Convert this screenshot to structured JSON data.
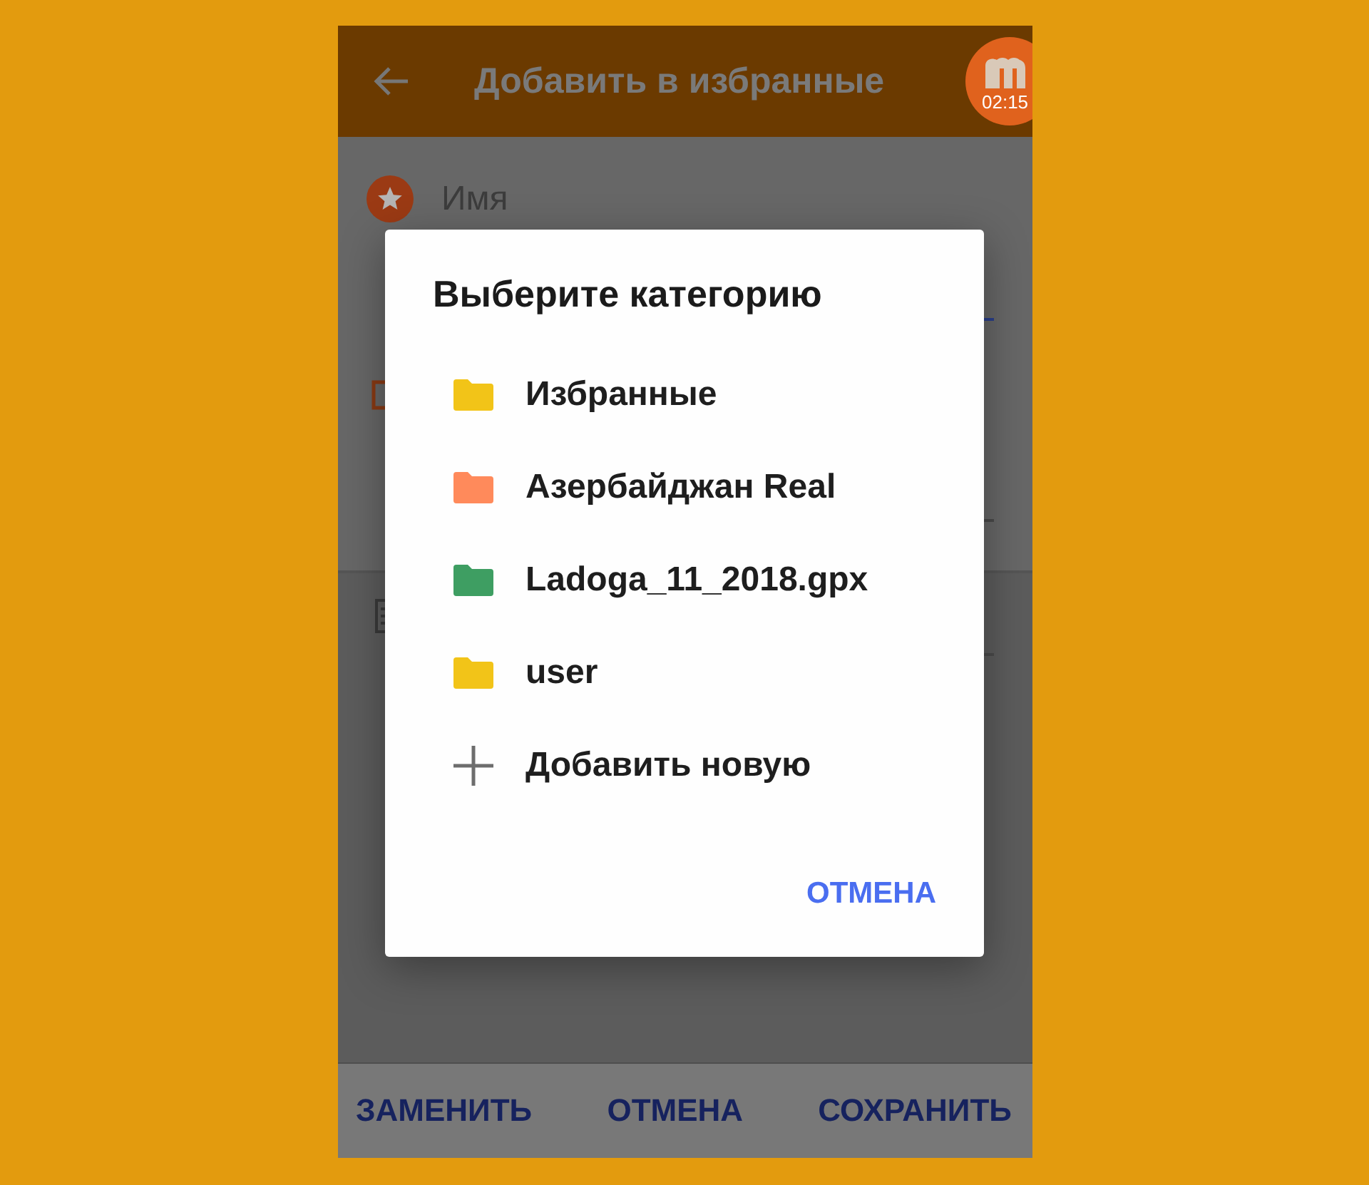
{
  "app_bar": {
    "title": "Добавить в избранные"
  },
  "recorder_badge": {
    "time": "02:15"
  },
  "form": {
    "name_label": "Имя"
  },
  "dialog": {
    "title": "Выберите категорию",
    "categories": [
      {
        "name": "Избранные",
        "color": "#f2c418"
      },
      {
        "name": "Азербайджан Real",
        "color": "#ff8a5b"
      },
      {
        "name": "Ladoga_11_2018.gpx",
        "color": "#3e9e62"
      },
      {
        "name": "user",
        "color": "#f2c418"
      }
    ],
    "add_new": "Добавить новую",
    "cancel": "ОТМЕНА"
  },
  "bottom_actions": [
    "ЗАМЕНИТЬ",
    "ОТМЕНА",
    "СОХРАНИТЬ"
  ]
}
